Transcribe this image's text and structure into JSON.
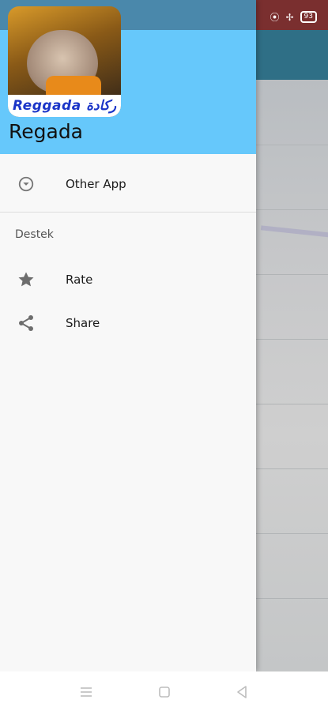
{
  "drawer": {
    "app_name": "Regada",
    "logo_text": "Reggada ركادة",
    "items": [
      {
        "label": "Other App",
        "icon": "dropdown-circle-icon"
      },
      {
        "label": "Rate",
        "icon": "star-icon"
      },
      {
        "label": "Share",
        "icon": "share-icon"
      }
    ],
    "section_title": "Destek"
  },
  "status_bar": {
    "battery": "93"
  },
  "colors": {
    "header": "#66c8fb",
    "drawer_bg": "#f8f8f8",
    "status_bar": "#4a88ab",
    "toolbar": "#2f6f86",
    "logo_text": "#1b35c8"
  }
}
